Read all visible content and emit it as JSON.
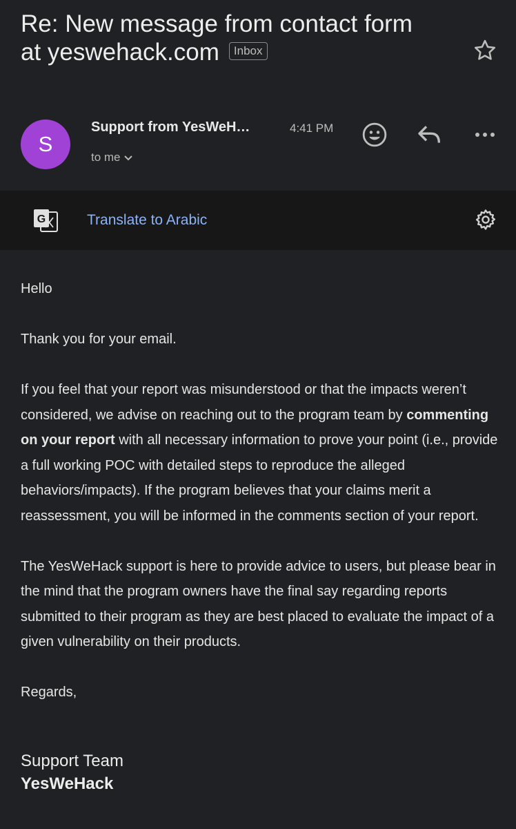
{
  "subject": {
    "line1": "Re: New message from contact form",
    "line2": "at yeswehack.com",
    "label": "Inbox"
  },
  "sender": {
    "avatar_letter": "S",
    "avatar_color": "#a142d6",
    "name": "Support from YesWeH…",
    "time": "4:41 PM",
    "recipient": "to me"
  },
  "icons": {
    "star": "star-icon",
    "emoji": "emoji-icon",
    "reply": "reply-icon",
    "more": "more-vert-icon",
    "translate": "translate-icon",
    "settings": "gear-icon"
  },
  "translate": {
    "link": "Translate to Arabic"
  },
  "message": {
    "greeting": "Hello",
    "thanks": "Thank you for your email.",
    "p1_before": "If you feel that your report was misunderstood or that the impacts weren’t considered, we advise on reaching out to the program team by ",
    "p1_bold": "commenting on your report",
    "p1_after": " with all necessary information to prove your point (i.e., provide a full working POC with detailed steps to reproduce the alleged behaviors/impacts). If the program believes that your claims merit a reassessment, you will be informed in the comments section of your report.",
    "p2": "The YesWeHack support is here to provide advice to users, but please bear in the mind that the program owners have the final say regarding reports submitted to their program as they are best placed to evaluate the impact of a given vulnerability on their products.",
    "closing": "Regards,"
  },
  "signature": {
    "team": "Support Team",
    "company": "YesWeHack"
  }
}
